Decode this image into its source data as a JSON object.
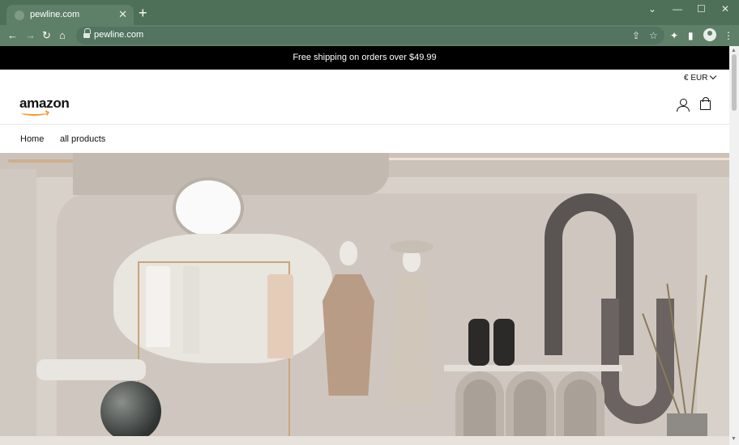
{
  "browser": {
    "tab_title": "pewline.com",
    "tab_close": "✕",
    "new_tab": "+",
    "url": "pewline.com",
    "window_controls": [
      "⌄",
      "—",
      "☐",
      "✕"
    ],
    "nav": {
      "back": "←",
      "forward": "→",
      "reload": "↻",
      "home": "⌂"
    },
    "toolbar_icons": {
      "share": "⇪",
      "bookmark": "☆",
      "extensions": "✦",
      "sidepanel": "▮",
      "menu": "⋮"
    }
  },
  "site": {
    "announcement": "Free shipping on orders over $49.99",
    "currency": "€ EUR",
    "logo_text": "amazon",
    "nav": [
      {
        "label": "Home"
      },
      {
        "label": "all products"
      }
    ]
  },
  "colors": {
    "chrome": "#5f8068",
    "tabstrip": "#4f7058",
    "announcement_bg": "#000000",
    "logo_accent": "#f0a02a"
  },
  "icons": {
    "account": "account-icon",
    "cart": "cart-icon",
    "lock": "lock-icon"
  }
}
